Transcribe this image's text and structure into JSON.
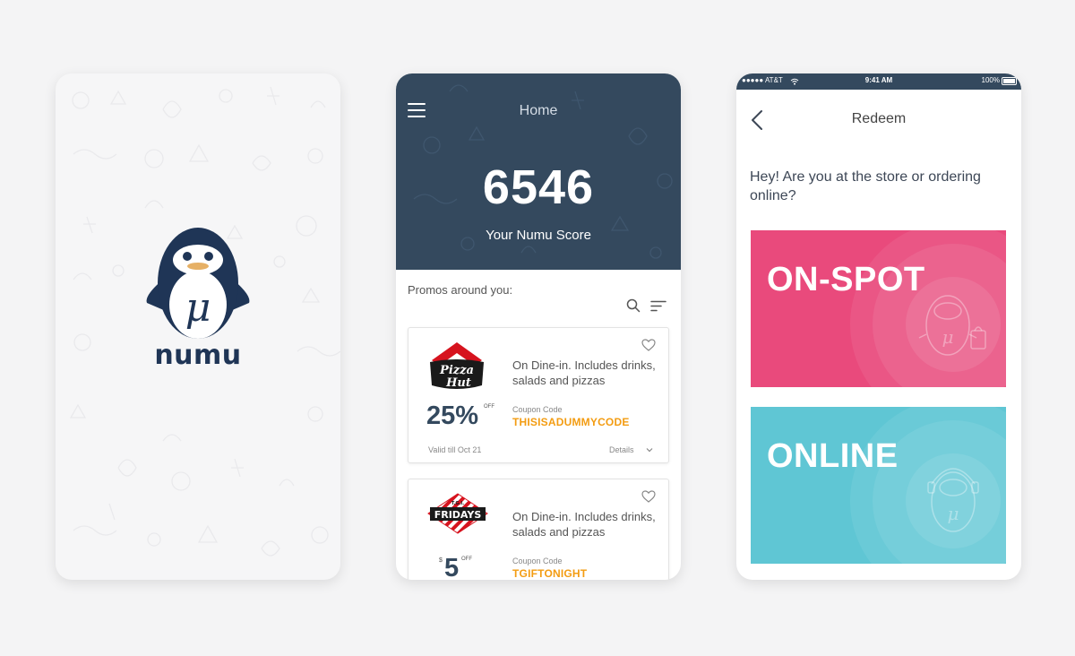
{
  "splash": {
    "logo_text": "numu"
  },
  "home": {
    "title": "Home",
    "score": "6546",
    "score_label": "Your Numu Score",
    "promos_label": "Promos around you:",
    "promos": [
      {
        "brand_logo_text": "Pizza Hut",
        "description": "On Dine-in. Includes drinks, salads and pizzas",
        "discount": "25%",
        "discount_unit": "OFF",
        "coupon_label": "Coupon Code",
        "coupon_code": "THISISADUMMYCODE",
        "valid_until": "Valid till Oct 21",
        "details_label": "Details"
      },
      {
        "brand_logo_text": "FRIDAYS",
        "brand_logo_subtext": "T.G.I.",
        "description": "On Dine-in. Includes drinks, salads and pizzas",
        "currency": "$",
        "discount": "5",
        "discount_unit": "OFF",
        "coupon_label": "Coupon Code",
        "coupon_code": "TGIFTONIGHT"
      }
    ]
  },
  "redeem": {
    "status_bar": {
      "carrier": "●●●●● AT&T",
      "time": "9:41 AM",
      "battery": "100%"
    },
    "title": "Redeem",
    "question": "Hey! Are you at the store or ordering online?",
    "options": [
      {
        "label": "ON-SPOT",
        "color": "#e94a7c"
      },
      {
        "label": "ONLINE",
        "color": "#5fc6d4"
      }
    ]
  },
  "colors": {
    "navy": "#34495e",
    "accent_orange": "#f39c12",
    "background": "#f4f4f5"
  },
  "icons": {
    "menu": "menu-icon",
    "search": "search-icon",
    "filter": "filter-icon",
    "heart": "heart-icon",
    "back": "chevron-left-icon",
    "details": "chevron-down-icon",
    "battery": "battery-icon",
    "wifi": "wifi-icon"
  }
}
